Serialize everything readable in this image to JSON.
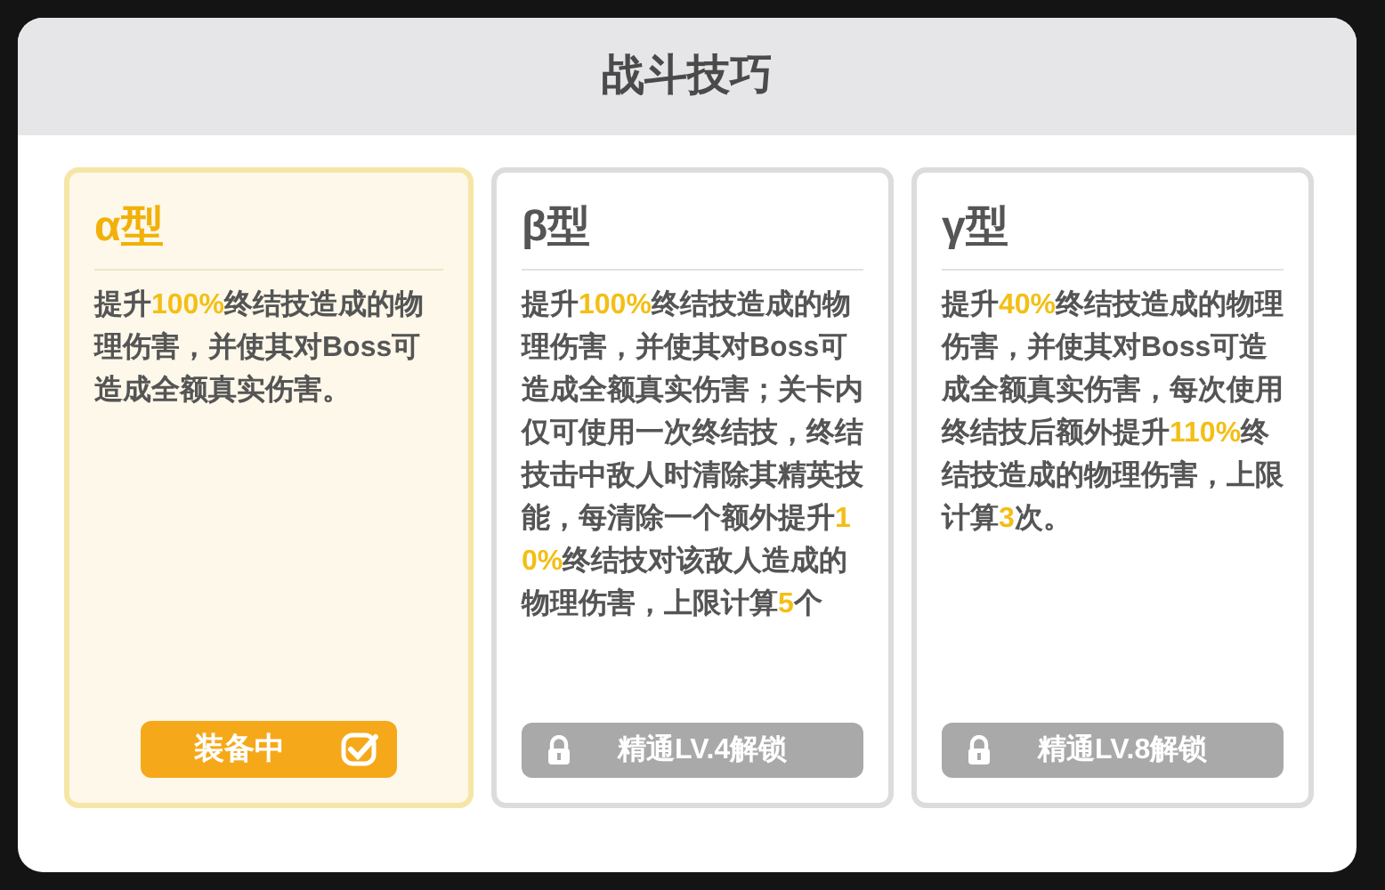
{
  "title": "战斗技巧",
  "cards": [
    {
      "name": "α型",
      "selected": true,
      "description": [
        {
          "text": "提升",
          "highlight": false
        },
        {
          "text": "100%",
          "highlight": true
        },
        {
          "text": "终结技造成的物理伤害，并使其对Boss可造成全额真实伤害。",
          "highlight": false
        }
      ],
      "action": {
        "kind": "equipped",
        "label": "装备中"
      }
    },
    {
      "name": "β型",
      "selected": false,
      "description": [
        {
          "text": "提升",
          "highlight": false
        },
        {
          "text": "100%",
          "highlight": true
        },
        {
          "text": "终结技造成的物理伤害，并使其对Boss可造成全额真实伤害；关卡内仅可使用一次终结技，终结技击中敌人时清除其精英技能，每清除一个额外提升",
          "highlight": false
        },
        {
          "text": "10%",
          "highlight": true
        },
        {
          "text": "终结技对该敌人造成的物理伤害，上限计算",
          "highlight": false
        },
        {
          "text": "5",
          "highlight": true
        },
        {
          "text": "个",
          "highlight": false
        }
      ],
      "action": {
        "kind": "locked",
        "label": "精通LV.4解锁"
      }
    },
    {
      "name": "γ型",
      "selected": false,
      "description": [
        {
          "text": "提升",
          "highlight": false
        },
        {
          "text": "40%",
          "highlight": true
        },
        {
          "text": "终结技造成的物理伤害，并使其对Boss可造成全额真实伤害，每次使用终结技后额外提升",
          "highlight": false
        },
        {
          "text": "110%",
          "highlight": true
        },
        {
          "text": "终结技造成的物理伤害，上限计算",
          "highlight": false
        },
        {
          "text": "3",
          "highlight": true
        },
        {
          "text": "次。",
          "highlight": false
        }
      ],
      "action": {
        "kind": "locked",
        "label": "精通LV.8解锁"
      }
    }
  ]
}
